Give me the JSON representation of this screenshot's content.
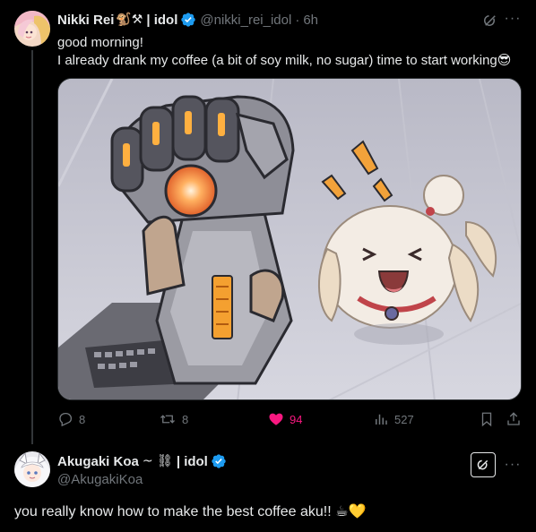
{
  "tweet": {
    "display_name": "Nikki Rei",
    "name_emojis": "🐒⚒",
    "name_suffix": "| idol",
    "handle": "@nikki_rei_idol",
    "time": "6h",
    "text_line1": "good morning!",
    "text_line2": "I already drank my coffee (a bit of soy milk, no sugar) time to start working😎",
    "stats": {
      "replies": "8",
      "reposts": "8",
      "likes": "94",
      "views": "527"
    }
  },
  "reply": {
    "display_name": "Akugaki Koa",
    "name_emojis": "~ ⛓",
    "name_suffix": "| idol",
    "handle": "@AkugakiKoa",
    "text": "you really know how to make the best coffee aku!! ☕💛"
  },
  "colors": {
    "background": "#000000",
    "text": "#e7e9ea",
    "secondary": "#71767b",
    "verified": "#1d9bf0",
    "like": "#f91880"
  }
}
